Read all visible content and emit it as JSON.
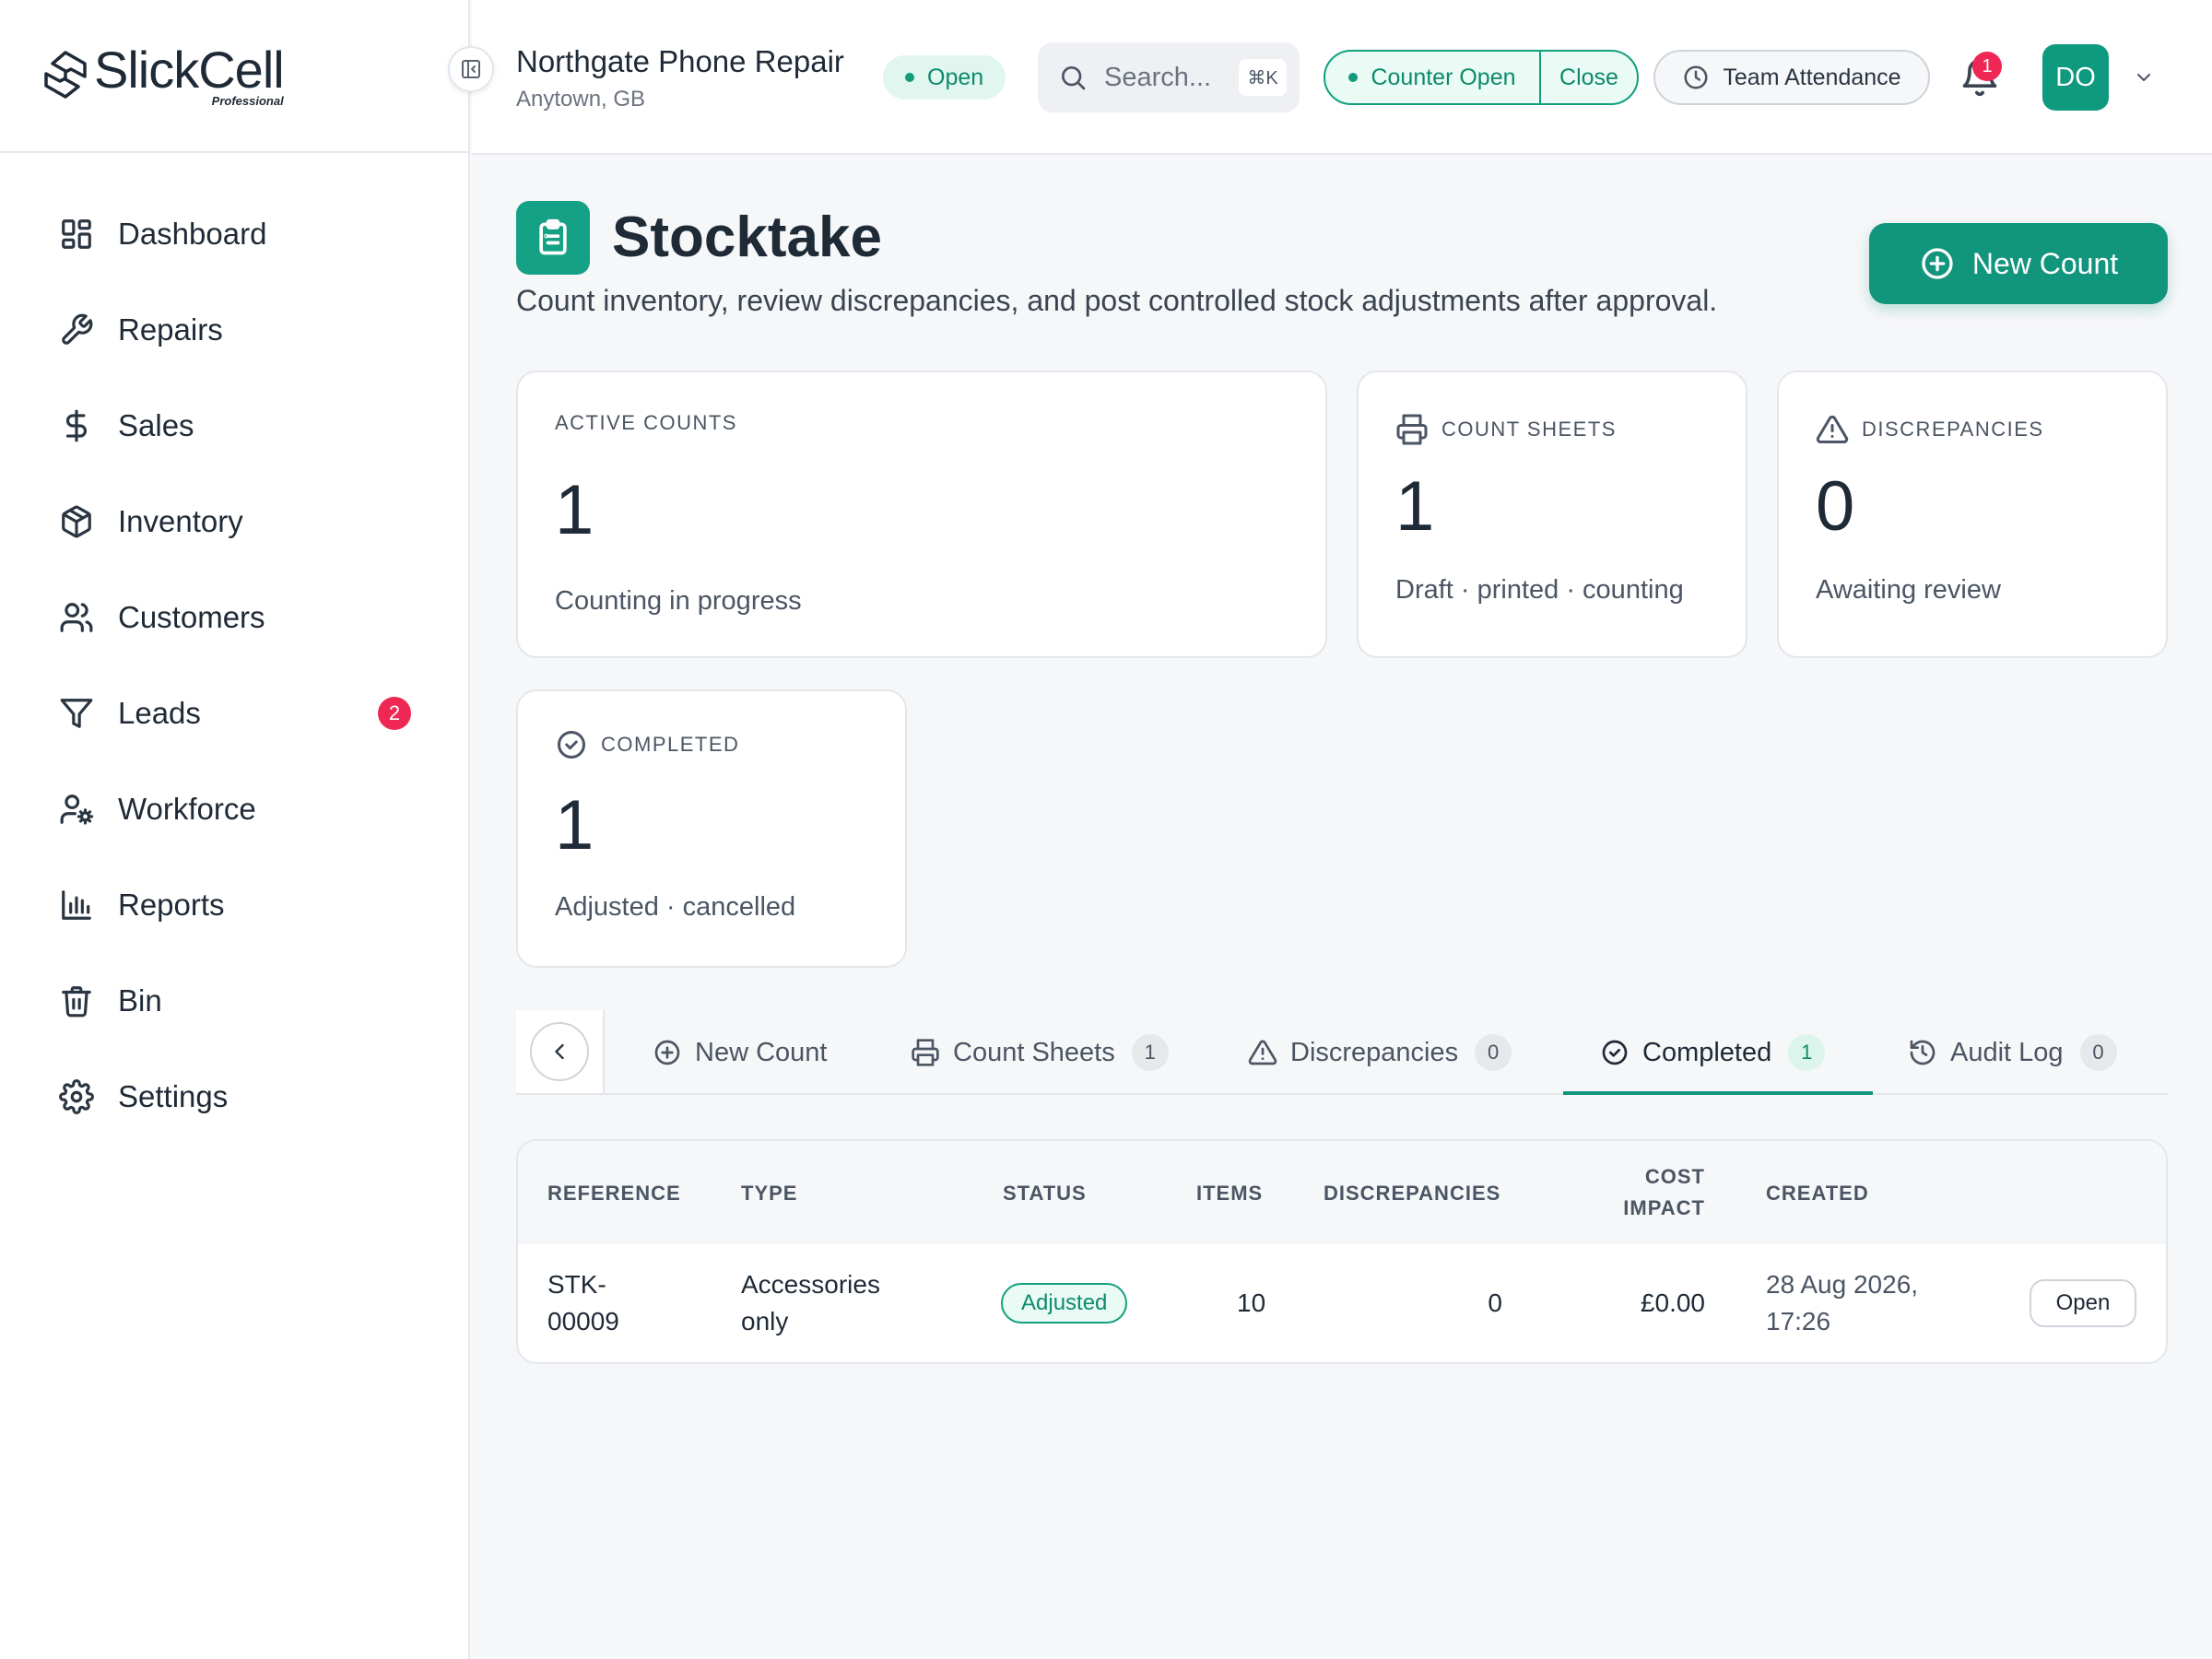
{
  "brand": {
    "name": "SlickCell",
    "edition": "Professional"
  },
  "sidebar": {
    "items": [
      {
        "label": "Dashboard",
        "icon": "dashboard-icon"
      },
      {
        "label": "Repairs",
        "icon": "wrench-icon"
      },
      {
        "label": "Sales",
        "icon": "dollar-icon"
      },
      {
        "label": "Inventory",
        "icon": "box-icon"
      },
      {
        "label": "Customers",
        "icon": "users-icon"
      },
      {
        "label": "Leads",
        "icon": "funnel-icon",
        "badge": "2"
      },
      {
        "label": "Workforce",
        "icon": "user-gear-icon"
      },
      {
        "label": "Reports",
        "icon": "bar-chart-icon"
      },
      {
        "label": "Bin",
        "icon": "trash-icon"
      },
      {
        "label": "Settings",
        "icon": "gear-icon"
      }
    ]
  },
  "topbar": {
    "store_name": "Northgate Phone Repair",
    "store_location": "Anytown, GB",
    "store_status": "Open",
    "search_placeholder": "Search...",
    "search_shortcut": "⌘K",
    "counter_status": "Counter Open",
    "counter_close": "Close",
    "attendance": "Team Attendance",
    "notification_count": "1",
    "user_initials": "DO"
  },
  "page": {
    "title": "Stocktake",
    "subtitle": "Count inventory, review discrepancies, and post controlled stock adjustments after approval.",
    "new_count_button": "New Count"
  },
  "stats": {
    "active": {
      "label": "ACTIVE COUNTS",
      "value": "1",
      "desc": "Counting in progress"
    },
    "sheets": {
      "label": "COUNT SHEETS",
      "value": "1",
      "desc": "Draft · printed · counting"
    },
    "discrepancies": {
      "label": "DISCREPANCIES",
      "value": "0",
      "desc": "Awaiting review"
    },
    "completed": {
      "label": "COMPLETED",
      "value": "1",
      "desc": "Adjusted · cancelled"
    }
  },
  "tabs": [
    {
      "label": "New Count",
      "count": ""
    },
    {
      "label": "Count Sheets",
      "count": "1"
    },
    {
      "label": "Discrepancies",
      "count": "0"
    },
    {
      "label": "Completed",
      "count": "1",
      "active": true
    },
    {
      "label": "Audit Log",
      "count": "0"
    }
  ],
  "table": {
    "headers": {
      "reference": "REFERENCE",
      "type": "TYPE",
      "status": "STATUS",
      "items": "ITEMS",
      "discrepancies": "DISCREPANCIES",
      "cost_line1": "COST",
      "cost_line2": "IMPACT",
      "created": "CREATED"
    },
    "rows": [
      {
        "reference_line1": "STK-",
        "reference_line2": "00009",
        "type_line1": "Accessories",
        "type_line2": "only",
        "status": "Adjusted",
        "items": "10",
        "discrepancies": "0",
        "cost_impact": "£0.00",
        "created_line1": "28 Aug 2026,",
        "created_line2": "17:26",
        "action": "Open"
      }
    ]
  },
  "colors": {
    "accent": "#12957d",
    "badge": "#ee2754",
    "status_text": "#0d8a6c"
  }
}
